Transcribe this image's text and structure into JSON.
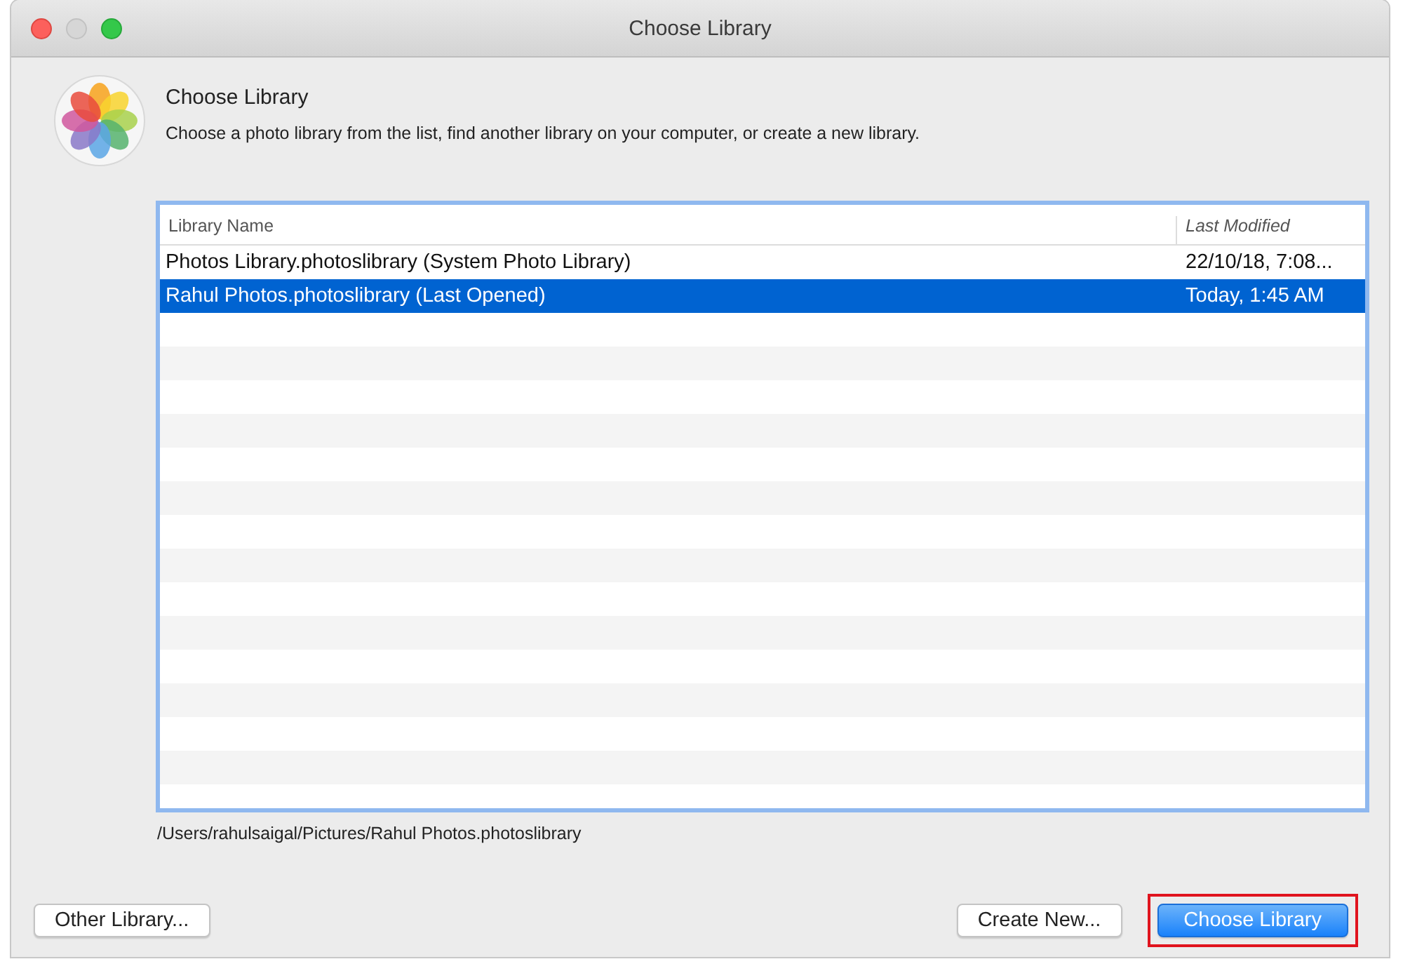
{
  "window": {
    "title": "Choose Library"
  },
  "header": {
    "title": "Choose Library",
    "description": "Choose a photo library from the list, find another library on your computer, or create a new library."
  },
  "table": {
    "columns": [
      "Library Name",
      "Last Modified"
    ],
    "rows": [
      {
        "name": "Photos Library.photoslibrary (System Photo Library)",
        "modified": "22/10/18, 7:08...",
        "selected": false
      },
      {
        "name": "Rahul Photos.photoslibrary (Last Opened)",
        "modified": "Today, 1:45 AM",
        "selected": true
      }
    ]
  },
  "path": "/Users/rahulsaigal/Pictures/Rahul Photos.photoslibrary",
  "buttons": [
    {
      "label": "Other Library...",
      "kind": "left",
      "default": false,
      "highlighted": false
    },
    {
      "label": "Create New...",
      "kind": "right",
      "default": false,
      "highlighted": false
    },
    {
      "label": "Choose Library",
      "kind": "right",
      "default": true,
      "highlighted": true
    }
  ]
}
